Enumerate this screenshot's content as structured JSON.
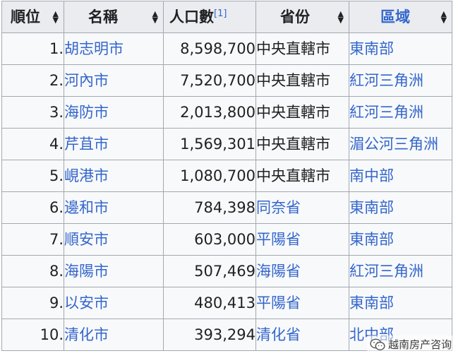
{
  "table": {
    "headers": {
      "rank": "順位",
      "city": "名稱",
      "population": "人口數",
      "population_ref": "[1]",
      "province": "省份",
      "region": "區域"
    },
    "rows": [
      {
        "rank": "1.",
        "city": "胡志明市",
        "population": "8,598,700",
        "province": "中央直轄市",
        "province_link": false,
        "region": "東南部"
      },
      {
        "rank": "2.",
        "city": "河內市",
        "population": "7,520,700",
        "province": "中央直轄市",
        "province_link": false,
        "region": "紅河三角洲"
      },
      {
        "rank": "3.",
        "city": "海防市",
        "population": "2,013,800",
        "province": "中央直轄市",
        "province_link": false,
        "region": "紅河三角洲"
      },
      {
        "rank": "4.",
        "city": "芹苴市",
        "population": "1,569,301",
        "province": "中央直轄市",
        "province_link": false,
        "region": "湄公河三角洲"
      },
      {
        "rank": "5.",
        "city": "峴港市",
        "population": "1,080,700",
        "province": "中央直轄市",
        "province_link": false,
        "region": "南中部"
      },
      {
        "rank": "6.",
        "city": "邊和市",
        "population": "784,398",
        "province": "同奈省",
        "province_link": true,
        "region": "東南部"
      },
      {
        "rank": "7.",
        "city": "順安市",
        "population": "603,000",
        "province": "平陽省",
        "province_link": true,
        "region": "東南部"
      },
      {
        "rank": "8.",
        "city": "海陽市",
        "population": "507,469",
        "province": "海陽省",
        "province_link": true,
        "region": "紅河三角洲"
      },
      {
        "rank": "9.",
        "city": "以安市",
        "population": "480,413",
        "province": "平陽省",
        "province_link": true,
        "region": "東南部"
      },
      {
        "rank": "10.",
        "city": "清化市",
        "population": "393,294",
        "province": "清化省",
        "province_link": true,
        "region": "北中部"
      }
    ]
  },
  "watermark": {
    "text": "越南房产咨询",
    "icon": "wechat-icon"
  },
  "colors": {
    "link": "#3366cc",
    "header_bg": "#eaecf0",
    "cell_bg": "#f8f9fa",
    "border": "#a2a9b1"
  }
}
